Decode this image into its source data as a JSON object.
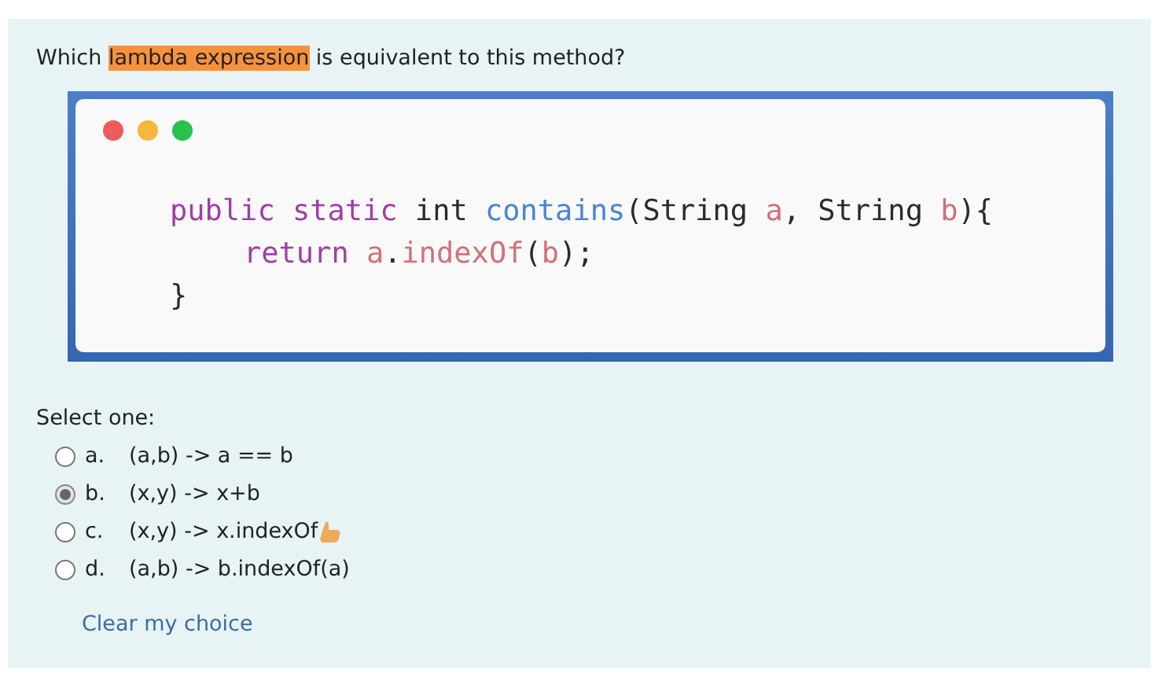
{
  "question": {
    "text": "Which **lambda expression** is equivalent to this method?",
    "code": {
      "lines": [
        {
          "tokens": [
            {
              "text": "public",
              "kind": "keyword"
            },
            {
              "text": " static",
              "kind": "keyword"
            },
            {
              "text": " int ",
              "kind": "plain"
            },
            {
              "text": "contains",
              "kind": "function"
            },
            {
              "text": "(String ",
              "kind": "plain"
            },
            {
              "text": "a",
              "kind": "param"
            },
            {
              "text": ", String ",
              "kind": "plain"
            },
            {
              "text": "b",
              "kind": "param"
            },
            {
              "text": "){",
              "kind": "plain"
            }
          ],
          "children": [
            {
              "tokens": [
                {
                  "text": "return",
                  "kind": "keyword"
                },
                {
                  "text": " a",
                  "kind": "param"
                },
                {
                  "text": ".",
                  "kind": "plain"
                },
                {
                  "text": "indexOf",
                  "kind": "param"
                },
                {
                  "text": "(",
                  "kind": "plain"
                },
                {
                  "text": "b",
                  "kind": "param"
                },
                {
                  "text": ");",
                  "kind": "plain"
                }
              ]
            }
          ]
        },
        {
          "tokens": [
            {
              "text": "}",
              "kind": "plain"
            }
          ]
        }
      ]
    }
  },
  "prompt": "Select one:",
  "options": [
    {
      "letter": "a.",
      "text": "(a,b) -> a == b",
      "selected": false
    },
    {
      "letter": "b.",
      "text": "(x,y) -> x+b",
      "selected": true
    },
    {
      "letter": "c.",
      "text": "(x,y) -> x.indexOf",
      "selected": false,
      "kind": "with-emoji"
    },
    {
      "letter": "d.",
      "text": "(a,b) -> b.indexOf(a)",
      "selected": false
    }
  ],
  "clear_link": "Clear my choice"
}
